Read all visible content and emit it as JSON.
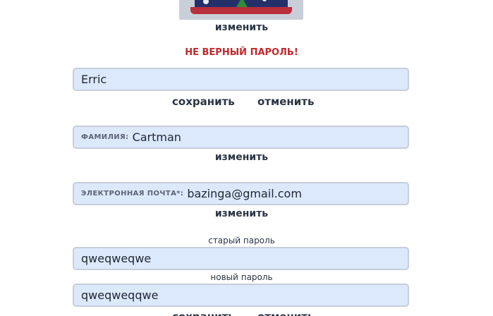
{
  "avatar": {
    "change_link": "изменить"
  },
  "error_message": "НЕ ВЕРНЫЙ ПАРОЛЬ!",
  "first_name": {
    "value": "Erric",
    "save_label": "сохранить",
    "cancel_label": "отменить"
  },
  "last_name": {
    "label": "ФАМИЛИЯ:",
    "value": "Cartman",
    "change_link": "изменить"
  },
  "email": {
    "label": "ЭЛЕКТРОННАЯ ПОЧТА*:",
    "value": "bazinga@gmail.com",
    "change_link": "изменить"
  },
  "password": {
    "old_caption": "старый пароль",
    "old_value": "qweqweqwe",
    "new_caption": "новый пароль",
    "new_value": "qweqweqqwe",
    "save_label": "сохранить",
    "cancel_label": "отменить"
  },
  "colors": {
    "field_bg": "#dce8fc",
    "field_border": "#c6ced9",
    "error": "#c0282d",
    "text": "#2b3544"
  }
}
